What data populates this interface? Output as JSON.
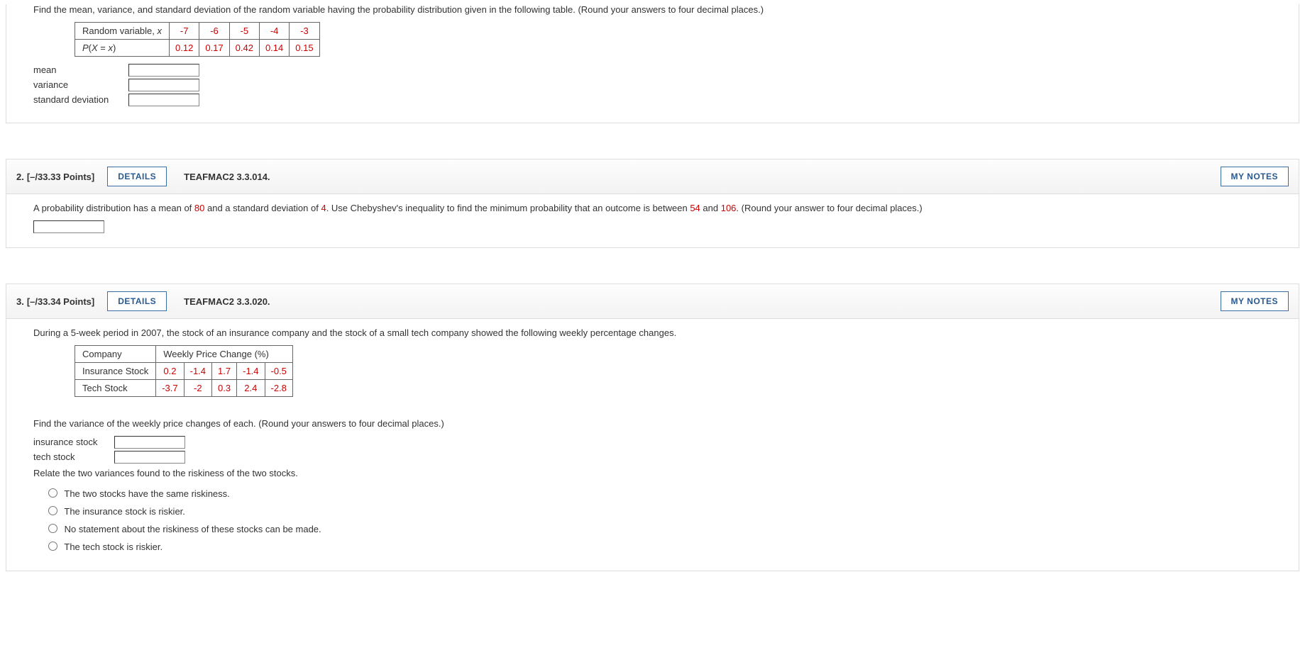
{
  "q1": {
    "prompt": "Find the mean, variance, and standard deviation of the random variable having the probability distribution given in the following table. (Round your answers to four decimal places.)",
    "table": {
      "row1_label": "Random variable, ",
      "row1_var": "x",
      "row2_label_a": "P",
      "row2_label_b": "(",
      "row2_label_c": "X",
      "row2_label_d": " = ",
      "row2_label_e": "x",
      "row2_label_f": ")",
      "x": [
        "-7",
        "-6",
        "-5",
        "-4",
        "-3"
      ],
      "p": [
        "0.12",
        "0.17",
        "0.42",
        "0.14",
        "0.15"
      ]
    },
    "labels": {
      "mean": "mean",
      "variance": "variance",
      "sd": "standard deviation"
    }
  },
  "q2": {
    "num": "2.",
    "points": "[–/33.33 Points]",
    "details": "DETAILS",
    "ref": "TEAFMAC2 3.3.014.",
    "mynotes": "MY NOTES",
    "text_a": "A probability distribution has a mean of ",
    "mean": "80",
    "text_b": " and a standard deviation of ",
    "sd": "4",
    "text_c": ". Use Chebyshev's inequality to find the minimum probability that an outcome is between ",
    "lo": "54",
    "text_d": " and ",
    "hi": "106",
    "text_e": ". (Round your answer to four decimal places.)"
  },
  "q3": {
    "num": "3.",
    "points": "[–/33.34 Points]",
    "details": "DETAILS",
    "ref": "TEAFMAC2 3.3.020.",
    "mynotes": "MY NOTES",
    "intro": "During a 5-week period in 2007, the stock of an insurance company and the stock of a small tech company showed the following weekly percentage changes.",
    "table": {
      "h1": "Company",
      "h2": "Weekly Price Change (%)",
      "r1": "Insurance Stock",
      "r1v": [
        "0.2",
        "-1.4",
        "1.7",
        "-1.4",
        "-0.5"
      ],
      "r2": "Tech Stock",
      "r2v": [
        "-3.7",
        "-2",
        "0.3",
        "2.4",
        "-2.8"
      ]
    },
    "instr": "Find the variance of the weekly price changes of each. (Round your answers to four decimal places.)",
    "labels": {
      "ins": "insurance stock",
      "tech": "tech stock"
    },
    "relate": "Relate the two variances found to the riskiness of the two stocks.",
    "options": [
      "The two stocks have the same riskiness.",
      "The insurance stock is riskier.",
      "No statement about the riskiness of these stocks can be made.",
      "The tech stock is riskier."
    ]
  }
}
